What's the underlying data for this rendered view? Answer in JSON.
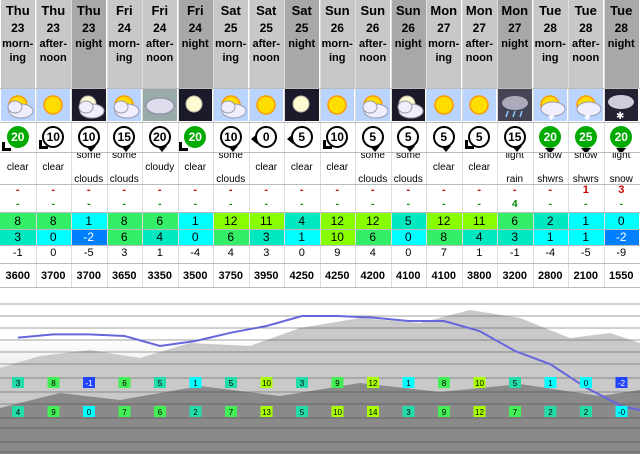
{
  "columns": [
    {
      "day": "Thu",
      "date": "23",
      "time_lines": [
        "morn-",
        "ing"
      ],
      "dark": false,
      "icon": "sun-cloud",
      "wind": "20",
      "wind_dir": "sw",
      "wind_style": "strong",
      "desc": [
        "clear"
      ],
      "rain": "-",
      "snow": "-",
      "tmax": "8",
      "tmin": "3",
      "feels": "-1",
      "fl": "3600"
    },
    {
      "day": "Thu",
      "date": "23",
      "time_lines": [
        "after-",
        "noon"
      ],
      "dark": false,
      "icon": "sun",
      "wind": "10",
      "wind_dir": "sw",
      "wind_style": "white",
      "desc": [
        "clear"
      ],
      "rain": "-",
      "snow": "-",
      "tmax": "8",
      "tmin": "0",
      "feels": "0",
      "fl": "3700"
    },
    {
      "day": "Thu",
      "date": "23",
      "time_lines": [
        "night"
      ],
      "dark": true,
      "icon": "moon-cloud",
      "wind": "10",
      "wind_dir": "s",
      "wind_style": "white",
      "desc": [
        "some",
        "clouds"
      ],
      "rain": "-",
      "snow": "-",
      "tmax": "1",
      "tmin": "-2",
      "feels": "-5",
      "fl": "3700"
    },
    {
      "day": "Fri",
      "date": "24",
      "time_lines": [
        "morn-",
        "ing"
      ],
      "dark": false,
      "icon": "sun-cloud",
      "wind": "15",
      "wind_dir": "s",
      "wind_style": "white",
      "desc": [
        "some",
        "clouds"
      ],
      "rain": "-",
      "snow": "-",
      "tmax": "8",
      "tmin": "6",
      "feels": "3",
      "fl": "3650"
    },
    {
      "day": "Fri",
      "date": "24",
      "time_lines": [
        "after-",
        "noon"
      ],
      "dark": false,
      "icon": "cloud",
      "wind": "20",
      "wind_dir": "s",
      "wind_style": "white",
      "desc": [
        "cloudy"
      ],
      "rain": "-",
      "snow": "-",
      "tmax": "6",
      "tmin": "4",
      "feels": "1",
      "fl": "3350"
    },
    {
      "day": "Fri",
      "date": "24",
      "time_lines": [
        "night"
      ],
      "dark": true,
      "icon": "moon",
      "wind": "20",
      "wind_dir": "sw",
      "wind_style": "strong",
      "desc": [
        "clear"
      ],
      "rain": "-",
      "snow": "-",
      "tmax": "1",
      "tmin": "0",
      "feels": "-4",
      "fl": "3500"
    },
    {
      "day": "Sat",
      "date": "25",
      "time_lines": [
        "morn-",
        "ing"
      ],
      "dark": false,
      "icon": "sun-cloud",
      "wind": "10",
      "wind_dir": "s",
      "wind_style": "white",
      "desc": [
        "some",
        "clouds"
      ],
      "rain": "-",
      "snow": "-",
      "tmax": "12",
      "tmin": "6",
      "feels": "4",
      "fl": "3750"
    },
    {
      "day": "Sat",
      "date": "25",
      "time_lines": [
        "after-",
        "noon"
      ],
      "dark": false,
      "icon": "sun",
      "wind": "0",
      "wind_dir": "w",
      "wind_style": "white",
      "desc": [
        "clear"
      ],
      "rain": "-",
      "snow": "-",
      "tmax": "11",
      "tmin": "3",
      "feels": "3",
      "fl": "3950"
    },
    {
      "day": "Sat",
      "date": "25",
      "time_lines": [
        "night"
      ],
      "dark": true,
      "icon": "moon",
      "wind": "5",
      "wind_dir": "w",
      "wind_style": "white",
      "desc": [
        "clear"
      ],
      "rain": "-",
      "snow": "-",
      "tmax": "4",
      "tmin": "1",
      "feels": "0",
      "fl": "4250"
    },
    {
      "day": "Sun",
      "date": "26",
      "time_lines": [
        "morn-",
        "ing"
      ],
      "dark": false,
      "icon": "sun",
      "wind": "10",
      "wind_dir": "sw",
      "wind_style": "white",
      "desc": [
        "clear"
      ],
      "rain": "-",
      "snow": "-",
      "tmax": "12",
      "tmin": "10",
      "feels": "9",
      "fl": "4250"
    },
    {
      "day": "Sun",
      "date": "26",
      "time_lines": [
        "after-",
        "noon"
      ],
      "dark": false,
      "icon": "sun-cloud",
      "wind": "5",
      "wind_dir": "s",
      "wind_style": "white",
      "desc": [
        "some",
        "clouds"
      ],
      "rain": "-",
      "snow": "-",
      "tmax": "12",
      "tmin": "6",
      "feels": "4",
      "fl": "4200"
    },
    {
      "day": "Sun",
      "date": "26",
      "time_lines": [
        "night"
      ],
      "dark": true,
      "icon": "moon-cloud",
      "wind": "5",
      "wind_dir": "s",
      "wind_style": "white",
      "desc": [
        "some",
        "clouds"
      ],
      "rain": "-",
      "snow": "-",
      "tmax": "5",
      "tmin": "0",
      "feels": "0",
      "fl": "4100"
    },
    {
      "day": "Mon",
      "date": "27",
      "time_lines": [
        "morn-",
        "ing"
      ],
      "dark": false,
      "icon": "sun",
      "wind": "5",
      "wind_dir": "s",
      "wind_style": "white",
      "desc": [
        "clear"
      ],
      "rain": "-",
      "snow": "-",
      "tmax": "12",
      "tmin": "8",
      "feels": "7",
      "fl": "4100"
    },
    {
      "day": "Mon",
      "date": "27",
      "time_lines": [
        "after-",
        "noon"
      ],
      "dark": false,
      "icon": "sun",
      "wind": "5",
      "wind_dir": "sw",
      "wind_style": "white",
      "desc": [
        "clear"
      ],
      "rain": "-",
      "snow": "-",
      "tmax": "11",
      "tmin": "4",
      "feels": "1",
      "fl": "3800"
    },
    {
      "day": "Mon",
      "date": "27",
      "time_lines": [
        "night"
      ],
      "dark": true,
      "icon": "rain-cloud",
      "wind": "15",
      "wind_dir": "s",
      "wind_style": "white",
      "desc": [
        "light",
        "rain"
      ],
      "rain": "4",
      "snow": "-",
      "tmax": "6",
      "tmin": "3",
      "feels": "-1",
      "fl": "3200"
    },
    {
      "day": "Tue",
      "date": "28",
      "time_lines": [
        "morn-",
        "ing"
      ],
      "dark": false,
      "icon": "snow-sun",
      "wind": "20",
      "wind_dir": "s",
      "wind_style": "strong",
      "desc": [
        "snow",
        "shwrs"
      ],
      "rain": "-",
      "snow": "-",
      "tmax": "2",
      "tmin": "1",
      "feels": "-4",
      "fl": "2800"
    },
    {
      "day": "Tue",
      "date": "28",
      "time_lines": [
        "after-",
        "noon"
      ],
      "dark": false,
      "icon": "snow-sun",
      "wind": "25",
      "wind_dir": "s",
      "wind_style": "strong",
      "desc": [
        "snow",
        "shwrs"
      ],
      "rain": "-",
      "snow": "1",
      "tmax": "1",
      "tmin": "1",
      "feels": "-5",
      "fl": "2100"
    },
    {
      "day": "Tue",
      "date": "28",
      "time_lines": [
        "night"
      ],
      "dark": true,
      "icon": "snow-cloud",
      "wind": "20",
      "wind_dir": "s",
      "wind_style": "strong",
      "desc": [
        "light",
        "snow"
      ],
      "rain": "-",
      "snow": "3",
      "tmax": "0",
      "tmin": "-2",
      "feels": "-9",
      "fl": "1550"
    }
  ],
  "freezing_level_line": [
    3600,
    3700,
    3700,
    3650,
    3350,
    3500,
    3750,
    3950,
    4250,
    4250,
    4200,
    4100,
    4100,
    3800,
    3200,
    2800,
    2100,
    1550
  ],
  "panorama_upper_tags": [
    "3",
    "8",
    "-1",
    "6",
    "5",
    "1",
    "5",
    "10",
    "3",
    "9",
    "12",
    "1",
    "8",
    "10",
    "5",
    "1",
    "0",
    "-2"
  ],
  "panorama_lower_tags": [
    "4",
    "9",
    "0",
    "7",
    "6",
    "2",
    "7",
    "13",
    "5",
    "10",
    "14",
    "3",
    "9",
    "12",
    "7",
    "2",
    "2",
    "-0"
  ],
  "colors": {
    "header_bg": "#c8c8c8",
    "header_night_bg": "#a8a8a8",
    "fl_line": "#6666dd",
    "cyan": "#00ffff",
    "green": "#66ff00",
    "teal": "#00ccaa",
    "blue": "#0066ff"
  }
}
